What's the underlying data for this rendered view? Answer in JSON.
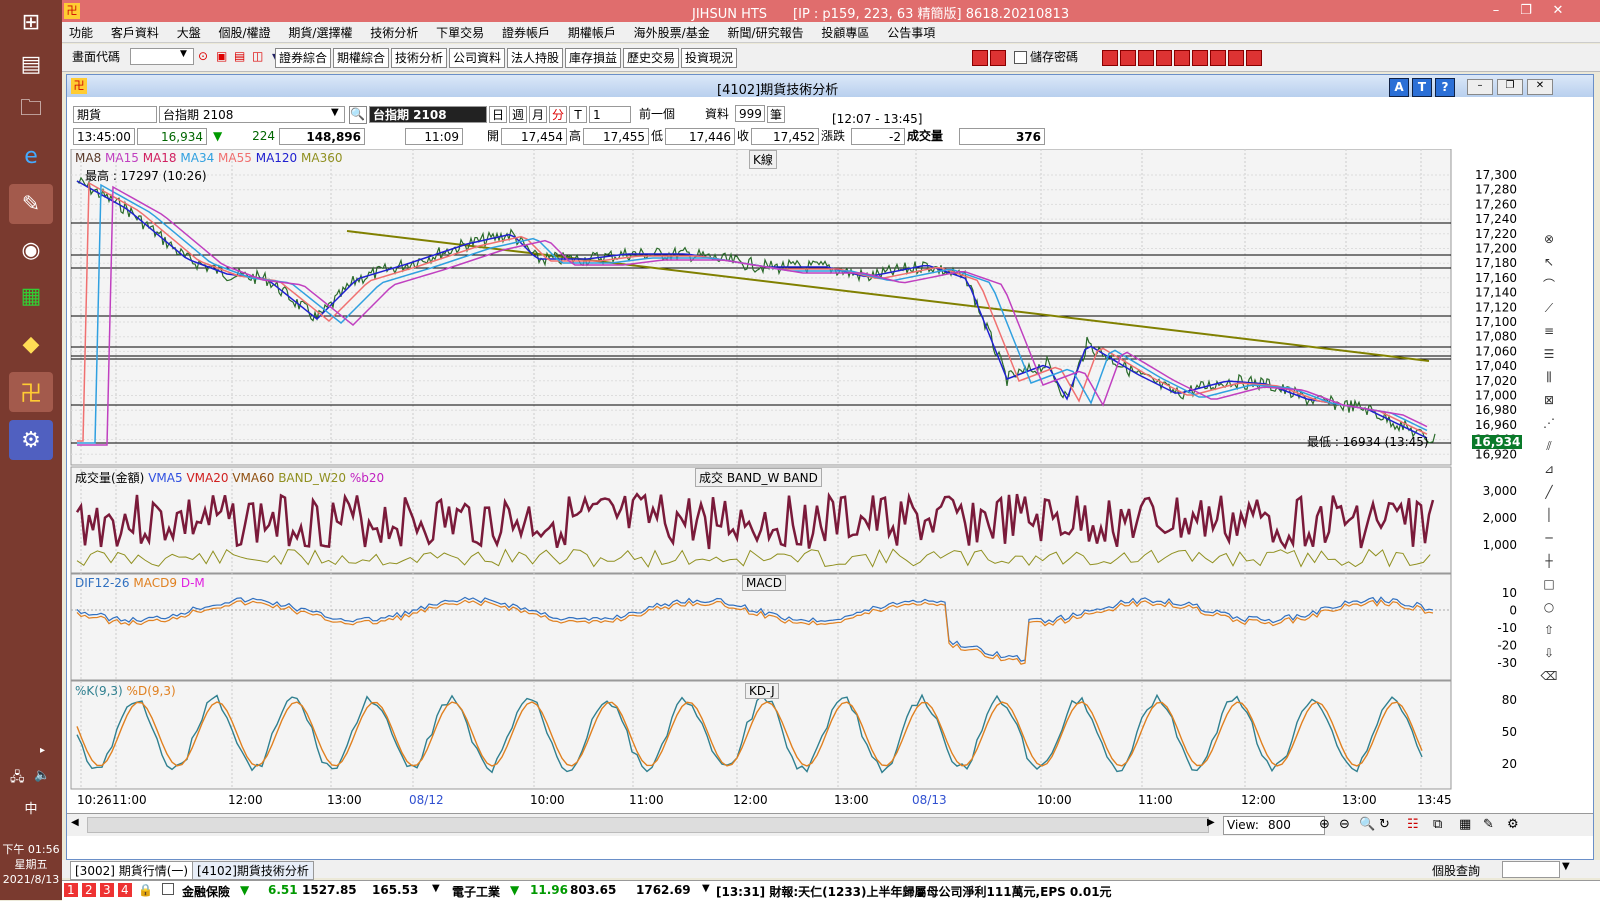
{
  "window": {
    "title": "JIHSUN HTS　　[IP : p159, 223, 63 精簡版] 8618.20210813"
  },
  "taskbar": {
    "clock_time": "下午 01:56",
    "clock_day": "星期五",
    "clock_date": "2021/8/13",
    "ime": "中"
  },
  "menu": [
    "功能",
    "客戶資料",
    "大盤",
    "個股/權證",
    "期貨/選擇權",
    "技術分析",
    "下單交易",
    "證券帳戶",
    "期權帳戶",
    "海外股票/基金",
    "新聞/研究報告",
    "投顧專區",
    "公告事項"
  ],
  "toolbar": {
    "code_label": "畫面代碼",
    "buttons": [
      "證券綜合",
      "期權綜合",
      "技術分析",
      "公司資料",
      "法人持股",
      "庫存損益",
      "歷史交易",
      "投資現況"
    ],
    "save_password": "儲存密碼"
  },
  "inner_window": {
    "title": "[4102]期貨技術分析",
    "icon_buttons": [
      "A",
      "T",
      "?"
    ]
  },
  "selector": {
    "market": "期貨",
    "product": "台指期 2108",
    "product_display": "台指期 2108",
    "periods": [
      "日",
      "週",
      "月",
      "分",
      "T"
    ],
    "period_value": "1",
    "prev_button": "前一個",
    "data_label": "資料",
    "data_value": "999",
    "data_unit": "筆",
    "time_range": "[12:07 - 13:45]"
  },
  "quote": {
    "time": "13:45:00",
    "price": "16,934",
    "change": "224",
    "volume_total": "148,896",
    "bar_time": "11:09",
    "open_label": "開",
    "open": "17,454",
    "high_label": "高",
    "high": "17,455",
    "low_label": "低",
    "low": "17,446",
    "close_label": "收",
    "close": "17,452",
    "chg_label": "漲跌",
    "chg": "-2",
    "vol_label": "成交量",
    "vol": "376"
  },
  "panels": {
    "kline": {
      "label": "K線",
      "legend": [
        "MA8",
        "MA15",
        "MA18",
        "MA34",
        "MA55",
        "MA120",
        "MA360"
      ],
      "legend_colors": [
        "#5a3a2a",
        "#c040c0",
        "#d02060",
        "#30a0e0",
        "#f07070",
        "#2020d0",
        "#909020"
      ],
      "high_note": "最高 : 17297 (10:26)",
      "low_note": "最低 : 16934 (13:45)",
      "last_price": "16,934",
      "y_ticks": [
        "17,300",
        "17,280",
        "17,260",
        "17,240",
        "17,220",
        "17,200",
        "17,180",
        "17,160",
        "17,140",
        "17,120",
        "17,100",
        "17,080",
        "17,060",
        "17,040",
        "17,020",
        "17,000",
        "16,980",
        "16,960",
        "16,940",
        "16,920"
      ]
    },
    "volume": {
      "label": "成交  BAND_W  BAND",
      "legend": [
        "成交量(金額)",
        "VMA5",
        "VMA20",
        "VMA60",
        "BAND_W20",
        "%b20"
      ],
      "legend_colors": [
        "#000000",
        "#3050e0",
        "#d02020",
        "#905010",
        "#909020",
        "#c020c0"
      ],
      "y_ticks": [
        "3,000",
        "2,000",
        "1,000"
      ]
    },
    "macd": {
      "label": "MACD",
      "legend": [
        "DIF12-26",
        "MACD9",
        "D-M"
      ],
      "legend_colors": [
        "#3070c0",
        "#e08020",
        "#e020e0"
      ],
      "y_ticks": [
        "10",
        "0",
        "-10",
        "-20",
        "-30"
      ]
    },
    "kd": {
      "label": "KD-J",
      "legend": [
        "%K(9,3)",
        "%D(9,3)"
      ],
      "legend_colors": [
        "#308090",
        "#e08020"
      ],
      "y_ticks": [
        "80",
        "50",
        "20"
      ]
    }
  },
  "time_axis": [
    "10:26",
    "11:00",
    "12:00",
    "13:00",
    "08/12",
    "10:00",
    "11:00",
    "12:00",
    "13:00",
    "08/13",
    "10:00",
    "11:00",
    "12:00",
    "13:00",
    "13:45"
  ],
  "view": {
    "label": "View:",
    "value": "800"
  },
  "tabs": [
    "[3002] 期貨行情(一)",
    "[4102]期貨技術分析"
  ],
  "bottom_right_label": "個股查詢",
  "status": {
    "tabs_num": [
      "1",
      "2",
      "3",
      "4"
    ],
    "sector1": "金融保險",
    "sector1_chg": "6.51",
    "sector1_idx": "1527.85",
    "sector1_vol": "165.53",
    "sector2": "電子工業",
    "sector2_chg": "11.96",
    "sector2_idx": "803.65",
    "sector2_vol": "1762.69",
    "news": "[13:31] 財報:天仁(1233)上半年歸屬母公司淨利111萬元,EPS 0.01元"
  }
}
